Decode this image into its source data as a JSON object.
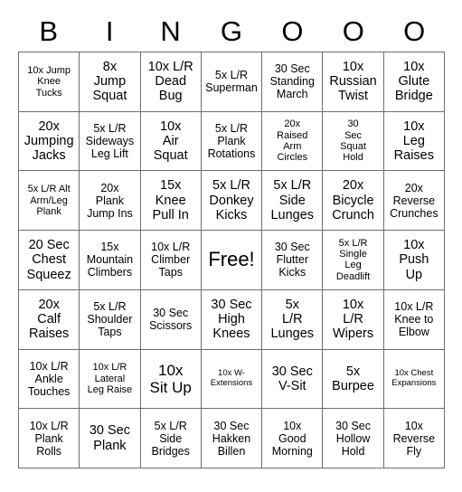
{
  "card": {
    "title_letters": [
      "B",
      "I",
      "N",
      "G",
      "O",
      "O",
      "O"
    ],
    "columns": 7,
    "rows": 7,
    "free_space_label": "Free!",
    "grid_line_color": "#6f6f6f",
    "background_color": "#ffffff",
    "text_color": "#000000"
  },
  "cells": [
    {
      "text": "10x Jump\nKnee\nTucks",
      "size": "s"
    },
    {
      "text": "8x\nJump\nSquat",
      "size": "l"
    },
    {
      "text": "10x L/R\nDead\nBug",
      "size": "l"
    },
    {
      "text": "5x L/R\nSuperman",
      "size": "m"
    },
    {
      "text": "30 Sec\nStanding\nMarch",
      "size": "m"
    },
    {
      "text": "10x\nRussian\nTwist",
      "size": "l"
    },
    {
      "text": "10x\nGlute\nBridge",
      "size": "l"
    },
    {
      "text": "20x\nJumping\nJacks",
      "size": "l"
    },
    {
      "text": "5x L/R\nSideways\nLeg Lift",
      "size": "m"
    },
    {
      "text": "10x\nAir\nSquat",
      "size": "l"
    },
    {
      "text": "5x L/R\nPlank\nRotations",
      "size": "m"
    },
    {
      "text": "20x\nRaised\nArm\nCircles",
      "size": "s"
    },
    {
      "text": "30\nSec\nSquat\nHold",
      "size": "s"
    },
    {
      "text": "10x\nLeg\nRaises",
      "size": "l"
    },
    {
      "text": "5x L/R Alt\nArm/Leg\nPlank",
      "size": "s"
    },
    {
      "text": "20x\nPlank\nJump Ins",
      "size": "m"
    },
    {
      "text": "15x\nKnee\nPull In",
      "size": "l"
    },
    {
      "text": "5x L/R\nDonkey\nKicks",
      "size": "l"
    },
    {
      "text": "5x L/R\nSide\nLunges",
      "size": "l"
    },
    {
      "text": "20x\nBicycle\nCrunch",
      "size": "l"
    },
    {
      "text": "20x\nReverse\nCrunches",
      "size": "m"
    },
    {
      "text": "20 Sec\nChest\nSqueez",
      "size": "l"
    },
    {
      "text": "15x\nMountain\nClimbers",
      "size": "m"
    },
    {
      "text": "10x L/R\nClimber\nTaps",
      "size": "m"
    },
    {
      "text": "Free!",
      "size": "xxl"
    },
    {
      "text": "30 Sec\nFlutter\nKicks",
      "size": "m"
    },
    {
      "text": "5x L/R\nSingle\nLeg\nDeadlift",
      "size": "s"
    },
    {
      "text": "10x\nPush\nUp",
      "size": "l"
    },
    {
      "text": "20x\nCalf\nRaises",
      "size": "l"
    },
    {
      "text": "5x L/R\nShoulder\nTaps",
      "size": "m"
    },
    {
      "text": "30 Sec\nScissors",
      "size": "m"
    },
    {
      "text": "30 Sec\nHigh\nKnees",
      "size": "l"
    },
    {
      "text": "5x\nL/R\nLunges",
      "size": "l"
    },
    {
      "text": "10x\nL/R\nWipers",
      "size": "l"
    },
    {
      "text": "10x L/R\nKnee to\nElbow",
      "size": "m"
    },
    {
      "text": "10x L/R\nAnkle\nTouches",
      "size": "m"
    },
    {
      "text": "10x L/R\nLateral\nLeg Raise",
      "size": "s"
    },
    {
      "text": "10x\nSit Up",
      "size": "xl"
    },
    {
      "text": "10x W-\nExtensions",
      "size": "xs"
    },
    {
      "text": "30 Sec\nV-Sit",
      "size": "l"
    },
    {
      "text": "5x\nBurpee",
      "size": "l"
    },
    {
      "text": "10x Chest\nExpansions",
      "size": "xs"
    },
    {
      "text": "10x L/R\nPlank\nRolls",
      "size": "m"
    },
    {
      "text": "30 Sec\nPlank",
      "size": "l"
    },
    {
      "text": "5x L/R\nSide\nBridges",
      "size": "m"
    },
    {
      "text": "30 Sec\nHakken\nBillen",
      "size": "m"
    },
    {
      "text": "10x\nGood\nMorning",
      "size": "m"
    },
    {
      "text": "30 Sec\nHollow\nHold",
      "size": "m"
    },
    {
      "text": "10x\nReverse\nFly",
      "size": "m"
    }
  ]
}
